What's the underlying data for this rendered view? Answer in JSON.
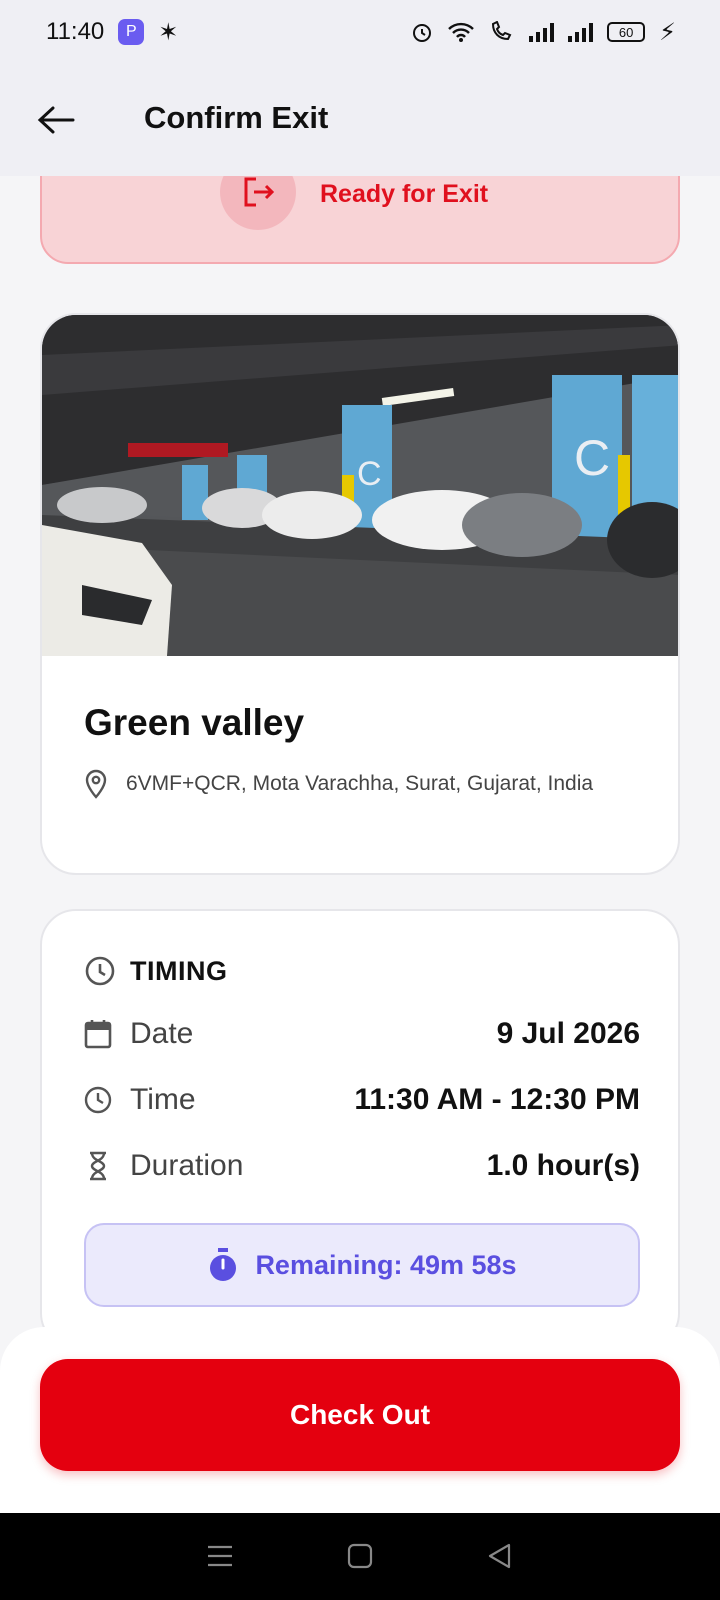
{
  "status_bar": {
    "time": "11:40",
    "battery": "60"
  },
  "header": {
    "title": "Confirm Exit"
  },
  "ready_banner": {
    "text": "Ready for Exit"
  },
  "location": {
    "name": "Green valley",
    "address": "6VMF+QCR, Mota Varachha, Surat, Gujarat, India"
  },
  "timing": {
    "title": "TIMING",
    "rows": [
      {
        "icon": "calendar-icon",
        "label": "Date",
        "value": "9 Jul 2026"
      },
      {
        "icon": "clock-icon",
        "label": "Time",
        "value": "11:30 AM - 12:30 PM"
      },
      {
        "icon": "hourglass-icon",
        "label": "Duration",
        "value": "1.0 hour(s)"
      }
    ],
    "remaining": "Remaining: 49m 58s"
  },
  "actions": {
    "checkout_label": "Check Out"
  },
  "colors": {
    "accent_red": "#e4000f",
    "banner_bg": "#f8d3d6",
    "remaining_purple": "#5a4fe0"
  }
}
